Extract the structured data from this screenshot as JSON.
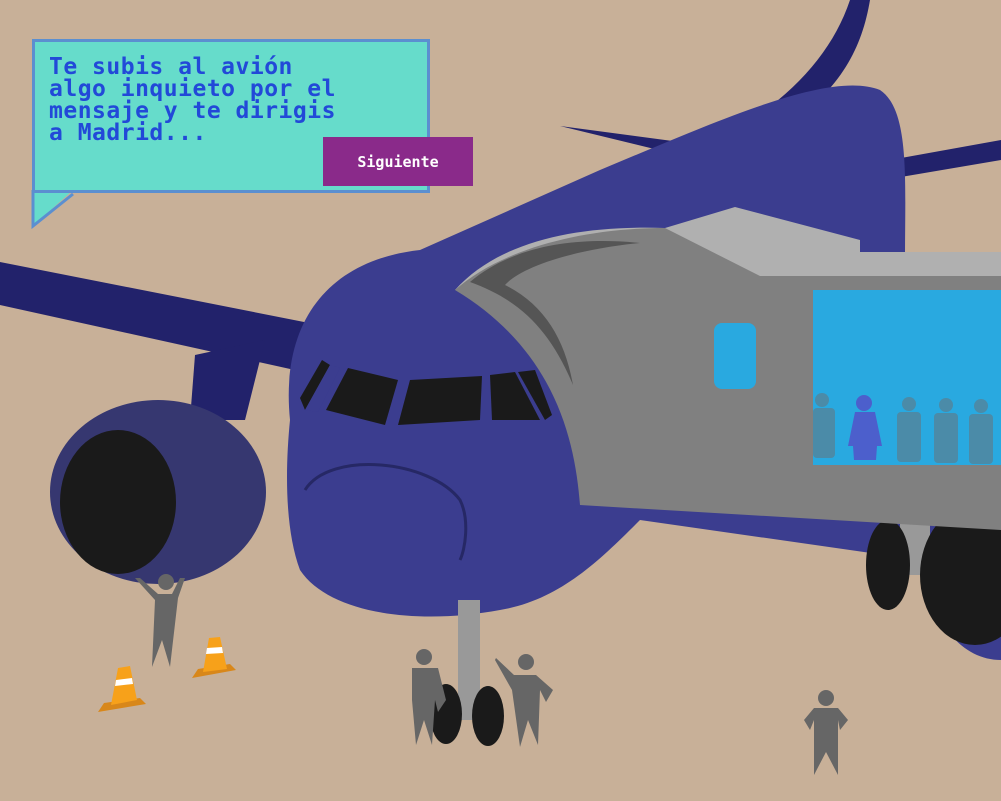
{
  "scene": {
    "name": "boarding-plane-to-madrid",
    "colors": {
      "ground": "#c8b098",
      "fuselage": "#3b3d8f",
      "wing_dark": "#22226b",
      "jetway": "#808080",
      "jetway_light": "#b0b0b0",
      "window_blue": "#29a9e0",
      "silhouette": "#666666",
      "cone_orange": "#f7a11a"
    }
  },
  "dialog": {
    "text": "Te subis al avión\nalgo inquieto por el\nmensaje y te dirigis\na Madrid...",
    "next_label": "Siguiente",
    "bg_color": "#66dccb",
    "border_color": "#5b8fd0",
    "text_color": "#2249d8",
    "button_color": "#8a2a8a"
  }
}
